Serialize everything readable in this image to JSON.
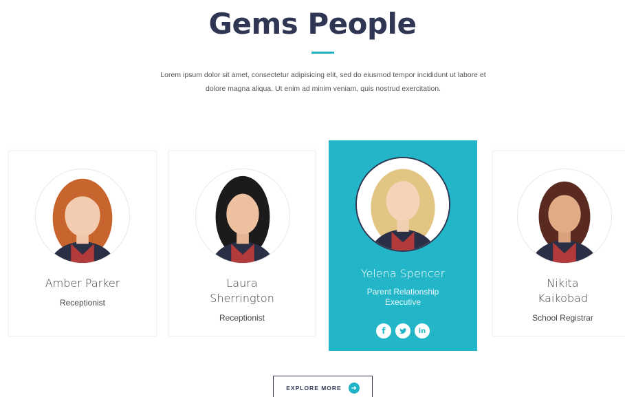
{
  "section": {
    "title": "Gems People",
    "intro": "Lorem ipsum dolor sit amet, consectetur adipisicing elit, sed do eiusmod tempor incididunt ut labore et dolore magna aliqua. Ut enim ad minim veniam, quis nostrud exercitation."
  },
  "people": [
    {
      "name": "Amber Parker",
      "role": "Receptionist"
    },
    {
      "name": "Laura Sherrington",
      "role": "Receptionist"
    },
    {
      "name": "Yelena Spencer",
      "role": "Parent Relationship Executive",
      "socials": [
        "facebook-icon",
        "twitter-icon",
        "linkedin-icon"
      ]
    },
    {
      "name": "Nikita Kaikobad",
      "role": "School Registrar"
    }
  ],
  "explore": {
    "label": "EXPLORE MORE",
    "icon": "arrow-right-icon"
  },
  "colors": {
    "accent": "#22b6c8",
    "heading": "#2f3654"
  }
}
